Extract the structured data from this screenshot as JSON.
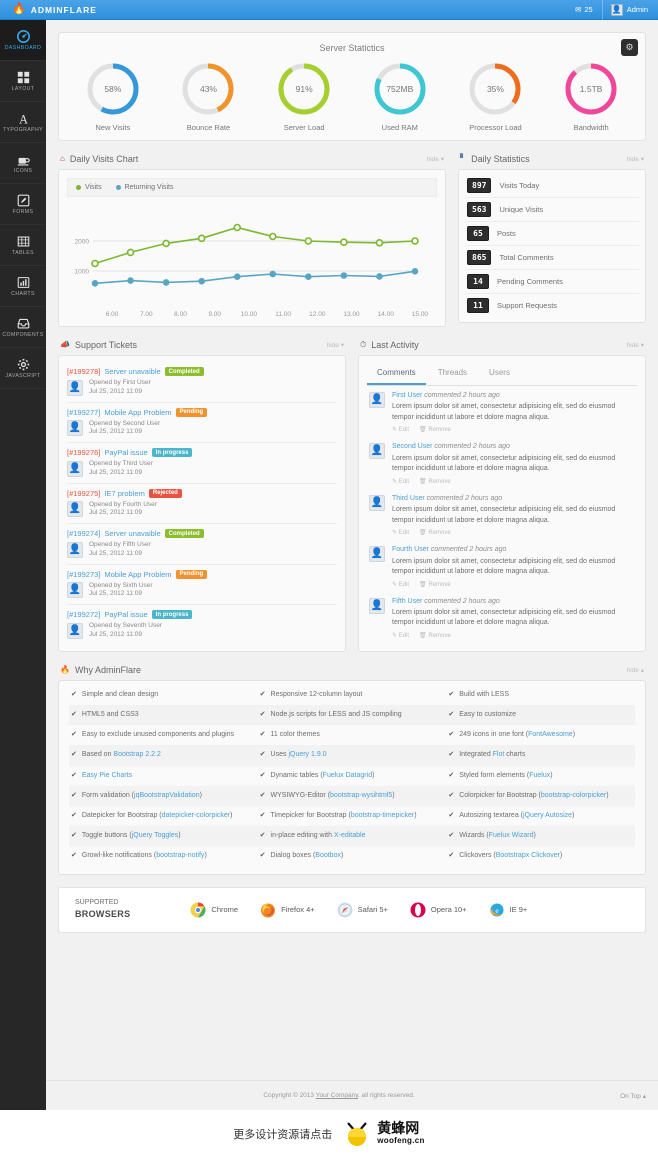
{
  "topbar": {
    "brand": "ADMINFLARE",
    "brand_icon": "flame-icon",
    "messages_count": "25",
    "messages_icon": "envelope-icon",
    "user_label": "Admin",
    "user_icon": "user-avatar-icon",
    "bg_color": "#2e8fdc"
  },
  "sidebar": {
    "items": [
      {
        "label": "DASHBOARD",
        "icon": "dashboard-icon",
        "active": true
      },
      {
        "label": "LAYOUT",
        "icon": "grid-icon",
        "active": false
      },
      {
        "label": "TYPOGRAPHY",
        "icon": "typography-icon",
        "active": false
      },
      {
        "label": "ICONS",
        "icon": "coffee-icon",
        "active": false
      },
      {
        "label": "FORMS",
        "icon": "pencil-square-icon",
        "active": false
      },
      {
        "label": "TABLES",
        "icon": "table-icon",
        "active": false
      },
      {
        "label": "CHARTS",
        "icon": "bar-chart-icon",
        "active": false
      },
      {
        "label": "COMPONENTS",
        "icon": "inbox-icon",
        "active": false
      },
      {
        "label": "JAVASCRIPT",
        "icon": "gear-icon",
        "active": false
      }
    ]
  },
  "server_statistics": {
    "title": "Server Statictics",
    "settings_icon": "gears-icon",
    "donuts": [
      {
        "value": "58%",
        "label": "New Visits",
        "percent": 58,
        "color": "#3498db"
      },
      {
        "value": "43%",
        "label": "Bounce Rate",
        "percent": 43,
        "color": "#f0932c"
      },
      {
        "value": "91%",
        "label": "Server Load",
        "percent": 91,
        "color": "#a5cf2e"
      },
      {
        "value": "752MB",
        "label": "Used RAM",
        "percent": 82,
        "color": "#3ec6d4"
      },
      {
        "value": "35%",
        "label": "Processor Load",
        "percent": 35,
        "color": "#ef6c1f"
      },
      {
        "value": "1.5TB",
        "label": "Bandwidth",
        "percent": 88,
        "color": "#f0479a"
      }
    ]
  },
  "daily_visits": {
    "title": "Daily Visits Chart",
    "icon": "home-icon",
    "hide_label": "hide"
  },
  "chart_data": {
    "type": "line",
    "title": "Daily Visits Chart",
    "xlabel": "",
    "ylabel": "",
    "x": [
      "6.00",
      "7.00",
      "8.00",
      "9.00",
      "10.00",
      "11.00",
      "12.00",
      "13.00",
      "14.00",
      "15.00"
    ],
    "ylim": [
      0,
      3000
    ],
    "yticks": [
      1000,
      2000
    ],
    "grid": true,
    "legend_position": "top-left",
    "series": [
      {
        "name": "Visits",
        "color": "#7cb82f",
        "marker": "open-circle",
        "values": [
          1250,
          1620,
          1920,
          2090,
          2450,
          2150,
          2000,
          1960,
          1940,
          2000
        ]
      },
      {
        "name": "Returning Visits",
        "color": "#58a6c4",
        "marker": "filled-circle",
        "values": [
          590,
          680,
          620,
          660,
          810,
          900,
          810,
          850,
          820,
          990
        ]
      }
    ]
  },
  "daily_statistics": {
    "title": "Daily Statistics",
    "icon": "bar-chart-icon",
    "hide_label": "hide",
    "rows": [
      {
        "value": "897",
        "label": "Visits Today"
      },
      {
        "value": "563",
        "label": "Unique Visits"
      },
      {
        "value": "65",
        "label": "Posts"
      },
      {
        "value": "865",
        "label": "Total Comments"
      },
      {
        "value": "14",
        "label": "Pending Comments"
      },
      {
        "value": "11",
        "label": "Support Requests"
      }
    ]
  },
  "support_tickets": {
    "title": "Support Tickets",
    "icon": "megaphone-icon",
    "hide_label": "hide",
    "tickets": [
      {
        "id": "[#199278]",
        "id_color": "red",
        "subject": "Server unavaible",
        "status": "Completed",
        "status_class": "completed",
        "opened_by": "Opened by First User",
        "date": "Jul 25, 2012 11:09"
      },
      {
        "id": "[#199277]",
        "id_color": "blue",
        "subject": "Mobile App Problem",
        "status": "Pending",
        "status_class": "pending",
        "opened_by": "Opened by Second User",
        "date": "Jul 25, 2012 11:09"
      },
      {
        "id": "[#199276]",
        "id_color": "red",
        "subject": "PayPal issue",
        "status": "In progress",
        "status_class": "progress",
        "opened_by": "Opened by Third User",
        "date": "Jul 25, 2012 11:09"
      },
      {
        "id": "[#199275]",
        "id_color": "red",
        "subject": "IE7 problem",
        "status": "Rejected",
        "status_class": "rejected",
        "opened_by": "Opened by Fourth User",
        "date": "Jul 25, 2012 11:09"
      },
      {
        "id": "[#199274]",
        "id_color": "blue",
        "subject": "Server unavaible",
        "status": "Completed",
        "status_class": "completed",
        "opened_by": "Opened by Fifth User",
        "date": "Jul 25, 2012 11:09"
      },
      {
        "id": "[#199273]",
        "id_color": "blue",
        "subject": "Mobile App Problem",
        "status": "Pending",
        "status_class": "pending",
        "opened_by": "Opened by Sixth User",
        "date": "Jul 25, 2012 11:09"
      },
      {
        "id": "[#199272]",
        "id_color": "blue",
        "subject": "PayPal issue",
        "status": "In progress",
        "status_class": "progress",
        "opened_by": "Opened by Seventh User",
        "date": "Jul 25, 2012 11:09"
      }
    ]
  },
  "last_activity": {
    "title": "Last Activity",
    "icon": "clock-icon",
    "hide_label": "hide",
    "tabs": [
      {
        "label": "Comments",
        "active": true
      },
      {
        "label": "Threads",
        "active": false
      },
      {
        "label": "Users",
        "active": false
      }
    ],
    "edit_label": "Edit",
    "remove_label": "Remove",
    "comments": [
      {
        "user": "First User",
        "action": "commented 2 hours ago",
        "text": "Lorem ipsum dolor sit amet, consectetur adipisicing elit, sed do eiusmod tempor incididunt ut labore et dolore magna aliqua."
      },
      {
        "user": "Second User",
        "action": "commented 2 hours ago",
        "text": "Lorem ipsum dolor sit amet, consectetur adipisicing elit, sed do eiusmod tempor incididunt ut labore et dolore magna aliqua."
      },
      {
        "user": "Third User",
        "action": "commented 2 hours ago",
        "text": "Lorem ipsum dolor sit amet, consectetur adipisicing elit, sed do eiusmod tempor incididunt ut labore et dolore magna aliqua."
      },
      {
        "user": "Fourth User",
        "action": "commented 2 hours ago",
        "text": "Lorem ipsum dolor sit amet, consectetur adipisicing elit, sed do eiusmod tempor incididunt ut labore et dolore magna aliqua."
      },
      {
        "user": "Fifth User",
        "action": "commented 2 hours ago",
        "text": "Lorem ipsum dolor sit amet, consectetur adipisicing elit, sed do eiusmod tempor incididunt ut labore et dolore magna aliqua."
      }
    ]
  },
  "why_adminflare": {
    "title": "Why AdminFlare",
    "icon": "flame-icon",
    "hide_label": "hide",
    "rows": [
      [
        {
          "text": "Simple and clean design"
        },
        {
          "text": "Responsive 12-column layout"
        },
        {
          "text": "Build with LESS"
        }
      ],
      [
        {
          "text": "HTML5 and CSS3"
        },
        {
          "text": "Node.js scripts for LESS and JS compiling"
        },
        {
          "text": "Easy to customize"
        }
      ],
      [
        {
          "text": "Easy to exclude unused components and plugins"
        },
        {
          "text": "11 color themes"
        },
        {
          "text": "249 icons in one font (",
          "link": "FontAwesome",
          "after": ")"
        }
      ],
      [
        {
          "text": "Based on ",
          "link": "Bootstrap 2.2.2"
        },
        {
          "text": "Uses ",
          "link": "jQuery 1.9.0"
        },
        {
          "text": "Integrated ",
          "link": "Flot",
          "after": " charts"
        }
      ],
      [
        {
          "link": "Easy Pie Charts"
        },
        {
          "text": "Dynamic tables (",
          "link": "Fuelux Datagrid",
          "after": ")"
        },
        {
          "text": "Styled form elements (",
          "link": "Fuelux",
          "after": ")"
        }
      ],
      [
        {
          "text": "Form validation (",
          "link": "jqBootstrapValidation",
          "after": ")"
        },
        {
          "text": "WYSIWYG-Editor (",
          "link": "bootstrap-wysihtml5",
          "after": ")"
        },
        {
          "text": "Colorpicker for Bootstrap (",
          "link": "bootstrap-colorpicker",
          "after": ")"
        }
      ],
      [
        {
          "text": "Datepicker for Bootstrap (",
          "link": "datepicker-colorpicker",
          "after": ")"
        },
        {
          "text": "Timepicker for Bootstrap (",
          "link": "bootstrap-timepicker",
          "after": ")"
        },
        {
          "text": "Autosizing textarea (",
          "link": "jQuery Autosize",
          "after": ")"
        }
      ],
      [
        {
          "text": "Toggle buttons (",
          "link": "jQuery Toggles",
          "after": ")"
        },
        {
          "text": "in-place editing with ",
          "link": "X-editable"
        },
        {
          "text": "Wizards (",
          "link": "Fuelux Wizard",
          "after": ")"
        }
      ],
      [
        {
          "text": "Growl-like notifications (",
          "link": "bootstrap-notify",
          "after": ")"
        },
        {
          "text": "Dialog boxes (",
          "link": "Bootbox",
          "after": ")"
        },
        {
          "text": "Clickovers (",
          "link": "Bootstrapx Clickover",
          "after": ")"
        }
      ]
    ]
  },
  "browsers": {
    "label_top": "SUPPORTED",
    "label_bottom": "BROWSERS",
    "items": [
      {
        "name": "Chrome",
        "icon": "chrome-icon"
      },
      {
        "name": "Firefox 4+",
        "icon": "firefox-icon"
      },
      {
        "name": "Safari 5+",
        "icon": "safari-icon"
      },
      {
        "name": "Opera 10+",
        "icon": "opera-icon"
      },
      {
        "name": "IE 9+",
        "icon": "ie-icon"
      }
    ]
  },
  "footer": {
    "copyright_pre": "Copyright © 2013 ",
    "company": "Your Company",
    "copyright_post": ", all rights reserved.",
    "on_top": "On Top"
  },
  "watermark": {
    "text": "更多设计资源请点击",
    "brand_cn": "黄蜂网",
    "brand_en": "woofeng.cn",
    "logo_icon": "bee-icon"
  }
}
